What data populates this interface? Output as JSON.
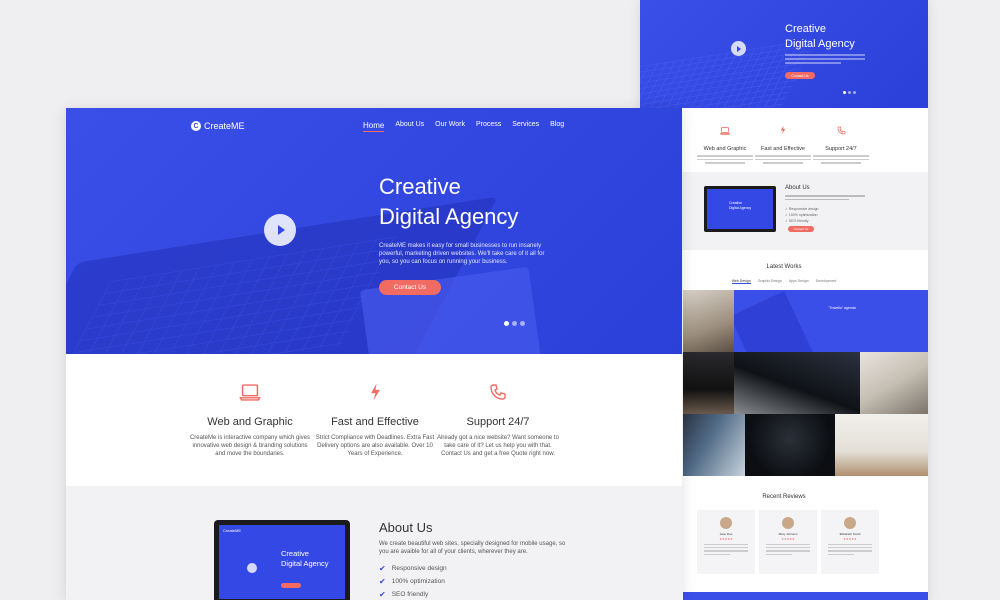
{
  "brand": {
    "name": "CreateME",
    "mark": "C"
  },
  "nav": {
    "items": [
      "Home",
      "About Us",
      "Our Work",
      "Process",
      "Services",
      "Blog"
    ]
  },
  "hero": {
    "title_line1": "Creative",
    "title_line2": "Digital Agency",
    "description": "CreateME makes it easy for small businesses to run insanely powerful, marketing driven websites. We'll take care of it all for you, so you can focus on running your business.",
    "cta_label": "Contact Us"
  },
  "features": [
    {
      "icon": "laptop-icon",
      "title": "Web and Graphic",
      "text": "CreateMe is interactive company which gives innovative web design & branding solutions and move the boundaries."
    },
    {
      "icon": "lightning-icon",
      "title": "Fast and Effective",
      "text": "Strict Compliance with Deadlines. Extra Fast Delivery options are also available. Over 10 Years of Experience."
    },
    {
      "icon": "phone-icon",
      "title": "Support 24/7",
      "text": "Already got a nice website? Want someone to take care of it? Let us help you with that. Contact Us and get a free Quote right now."
    }
  ],
  "about": {
    "title": "About Us",
    "description": "We create beautiful web sites, specially designed for mobile usage, so you are avaible for all of your clients, wherever they are.",
    "checks": [
      "Responsive design",
      "100% optimization",
      "SEO friendly"
    ],
    "mini_nav": "CreateME",
    "mini_title_line1": "Creative",
    "mini_title_line2": "Digital Agency",
    "button_label": "Contact Us"
  },
  "small": {
    "latest_works": "Latest Works",
    "filters": [
      "Web Design",
      "Graphic Design",
      "Apps Design",
      "Development"
    ],
    "portfolio_tile": "\"Travello\" agenda",
    "recent_reviews": "Recent Reviews",
    "reviewers": [
      "Jane Doe",
      "Mary Johnson",
      "Elizabeth Smith"
    ]
  },
  "colors": {
    "primary": "#3448e6",
    "accent": "#f26b63",
    "background": "#efeff1"
  }
}
